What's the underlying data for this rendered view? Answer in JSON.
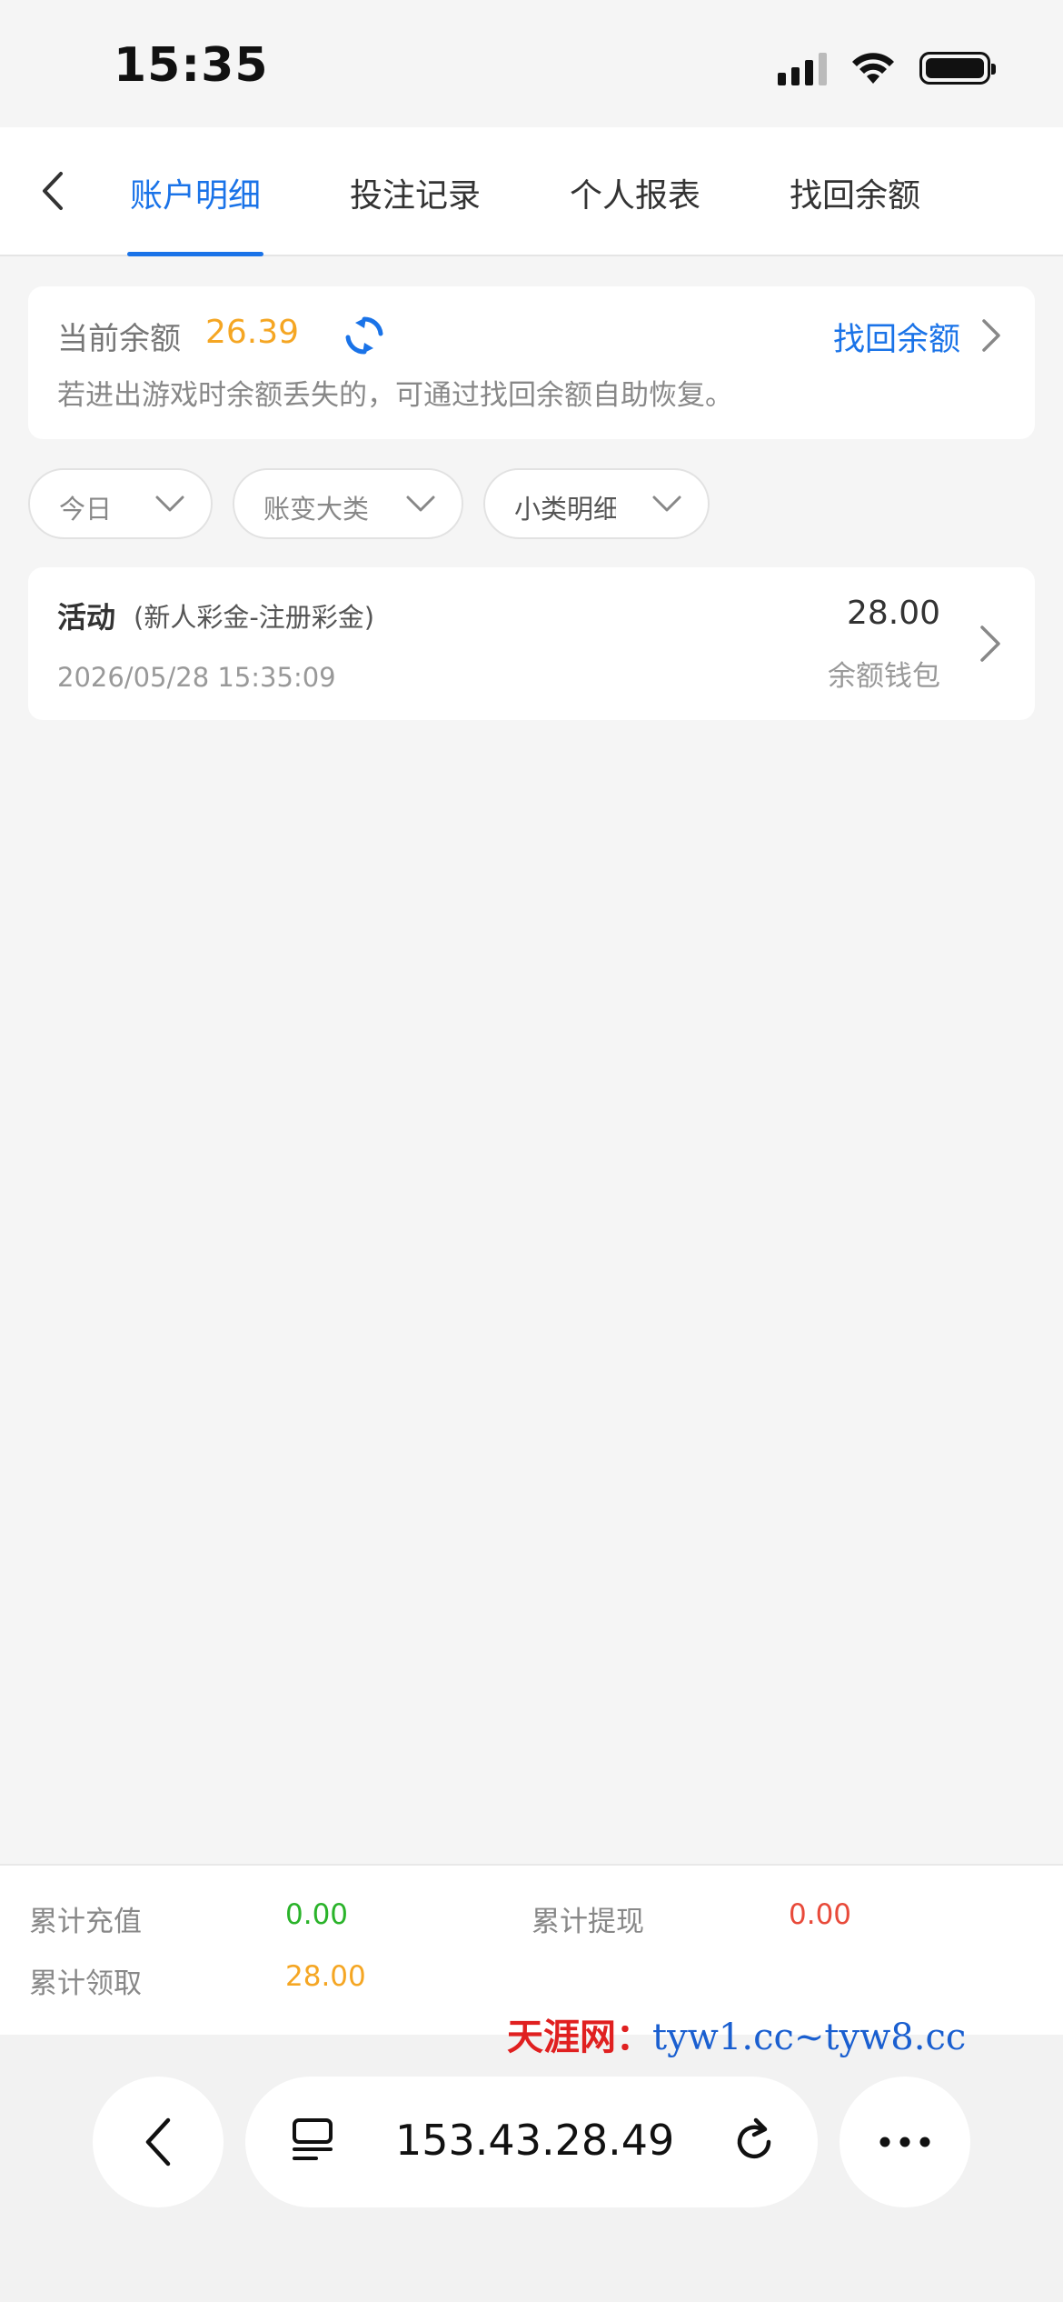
{
  "status_bar": {
    "time": "15:35"
  },
  "nav": {
    "tabs": [
      {
        "label": "账户明细",
        "active": true
      },
      {
        "label": "投注记录",
        "active": false
      },
      {
        "label": "个人报表",
        "active": false
      },
      {
        "label": "找回余额",
        "active": false
      }
    ]
  },
  "balance": {
    "label": "当前余额",
    "value": "26.39",
    "recover_link": "找回余额",
    "tip": "若进出游戏时余额丢失的，可通过找回余额自助恢复。"
  },
  "filters": [
    {
      "label": "今日"
    },
    {
      "label": "账变大类"
    },
    {
      "label": "小类明细"
    }
  ],
  "records": [
    {
      "type": "活动",
      "subtype": "(新人彩金-注册彩金)",
      "time": "2026/05/28 15:35:09",
      "amount": "28.00",
      "wallet": "余额钱包"
    }
  ],
  "summary": {
    "recharge_label": "累计充值",
    "recharge_value": "0.00",
    "withdraw_label": "累计提现",
    "withdraw_value": "0.00",
    "claim_label": "累计领取",
    "claim_value": "28.00"
  },
  "browser": {
    "url": "153.43.28.49"
  },
  "watermark": {
    "cn": "天涯网：",
    "url": "tyw1.cc~tyw8.cc"
  },
  "colors": {
    "accent": "#1a73e8",
    "balance": "#f5a623",
    "recharge": "#2ab32a",
    "withdraw": "#e84a3a",
    "claim": "#f5a623"
  }
}
